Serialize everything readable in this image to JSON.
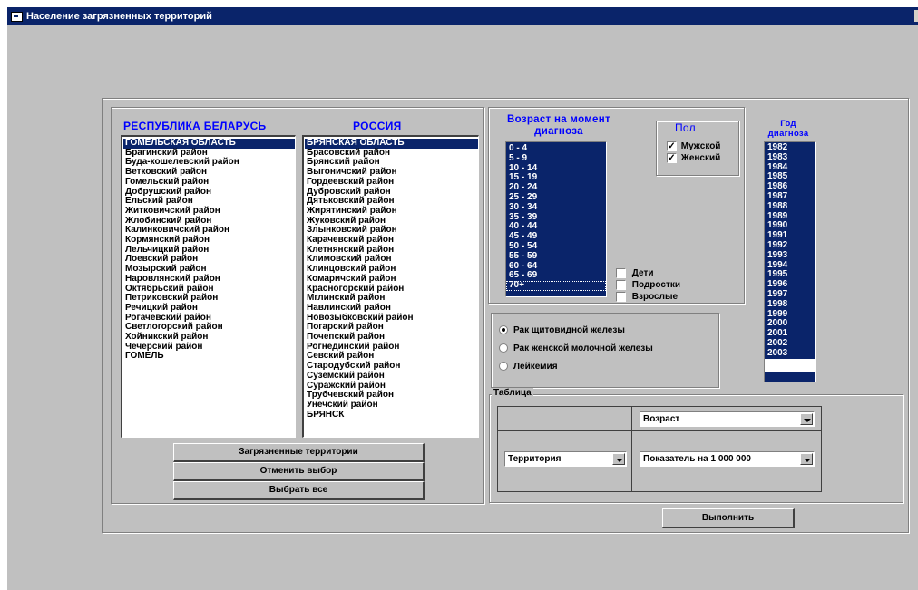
{
  "window": {
    "title": "Население загрязненных территорий"
  },
  "belarus": {
    "header": "РЕСПУБЛИКА БЕЛАРУСЬ",
    "items": [
      "ГОМЕЛЬСКАЯ ОБЛАСТЬ",
      "Брагинский район",
      "Буда-кошелевский район",
      "Ветковский район",
      "Гомельский район",
      "Добрушский район",
      "Ельский район",
      "Житковичский район",
      "Жлобинский район",
      "Калинковичский район",
      "Кормянский район",
      "Лельчицкий район",
      "Лоевский район",
      "Мозырский район",
      "Наровлянский район",
      "Октябрьский район",
      "Петриковский район",
      "Речицкий район",
      "Рогачевский район",
      "Светлогорский район",
      "Хойникский район",
      "Чечерский район",
      "ГОМЕЛЬ"
    ],
    "selected": 0
  },
  "russia": {
    "header": "РОССИЯ",
    "items": [
      "БРЯНСКАЯ ОБЛАСТЬ",
      "Брасовский район",
      "Брянский район",
      "Выгоничский район",
      "Гордеевский район",
      "Дубровский район",
      "Дятьковский район",
      "Жирятинский район",
      "Жуковский район",
      "Злынковский район",
      "Карачевский район",
      "Клетнянский район",
      "Климовский район",
      "Клинцовский район",
      "Комаричский район",
      "Красногорский район",
      "Мглинский район",
      "Навлинский район",
      "Новозыбковский район",
      "Погарский район",
      "Почепский район",
      "Рогнединский район",
      "Севский район",
      "Стародубский район",
      "Суземский район",
      "Суражский район",
      "Трубчевский район",
      "Унечский район",
      "БРЯНСК"
    ],
    "selected": 0
  },
  "buttons": {
    "contaminated": "Загрязненные территории",
    "cancel": "Отменить выбор",
    "select_all": "Выбрать все",
    "execute": "Выполнить"
  },
  "age": {
    "header": "Возраст на момент диагноза",
    "items": [
      "0 - 4",
      "5 - 9",
      "10 - 14",
      "15 - 19",
      "20 - 24",
      "25 - 29",
      "30 - 34",
      "35 - 39",
      "40 - 44",
      "45 - 49",
      "50 - 54",
      "55 - 59",
      "60 - 64",
      "65 - 69",
      "70+"
    ]
  },
  "sex": {
    "header": "Пол",
    "male": "Мужской",
    "male_checked": true,
    "female": "Женский",
    "female_checked": true
  },
  "age_groups": {
    "children": "Дети",
    "teens": "Подростки",
    "adults": "Взрослые"
  },
  "year": {
    "header": "Год диагноза",
    "items": [
      "1982",
      "1983",
      "1984",
      "1985",
      "1986",
      "1987",
      "1988",
      "1989",
      "1990",
      "1991",
      "1992",
      "1993",
      "1994",
      "1995",
      "1996",
      "1997",
      "1998",
      "1999",
      "2000",
      "2001",
      "2002",
      "2003"
    ]
  },
  "disease": {
    "options": [
      "Рак щитовидной железы",
      "Рак женской молочной железы",
      "Лейкемия"
    ],
    "selected": 0
  },
  "table": {
    "header": "Таблица",
    "column_select": "Возраст",
    "row_select": "Территория",
    "measure_select": "Показатель на 1 000 000"
  }
}
